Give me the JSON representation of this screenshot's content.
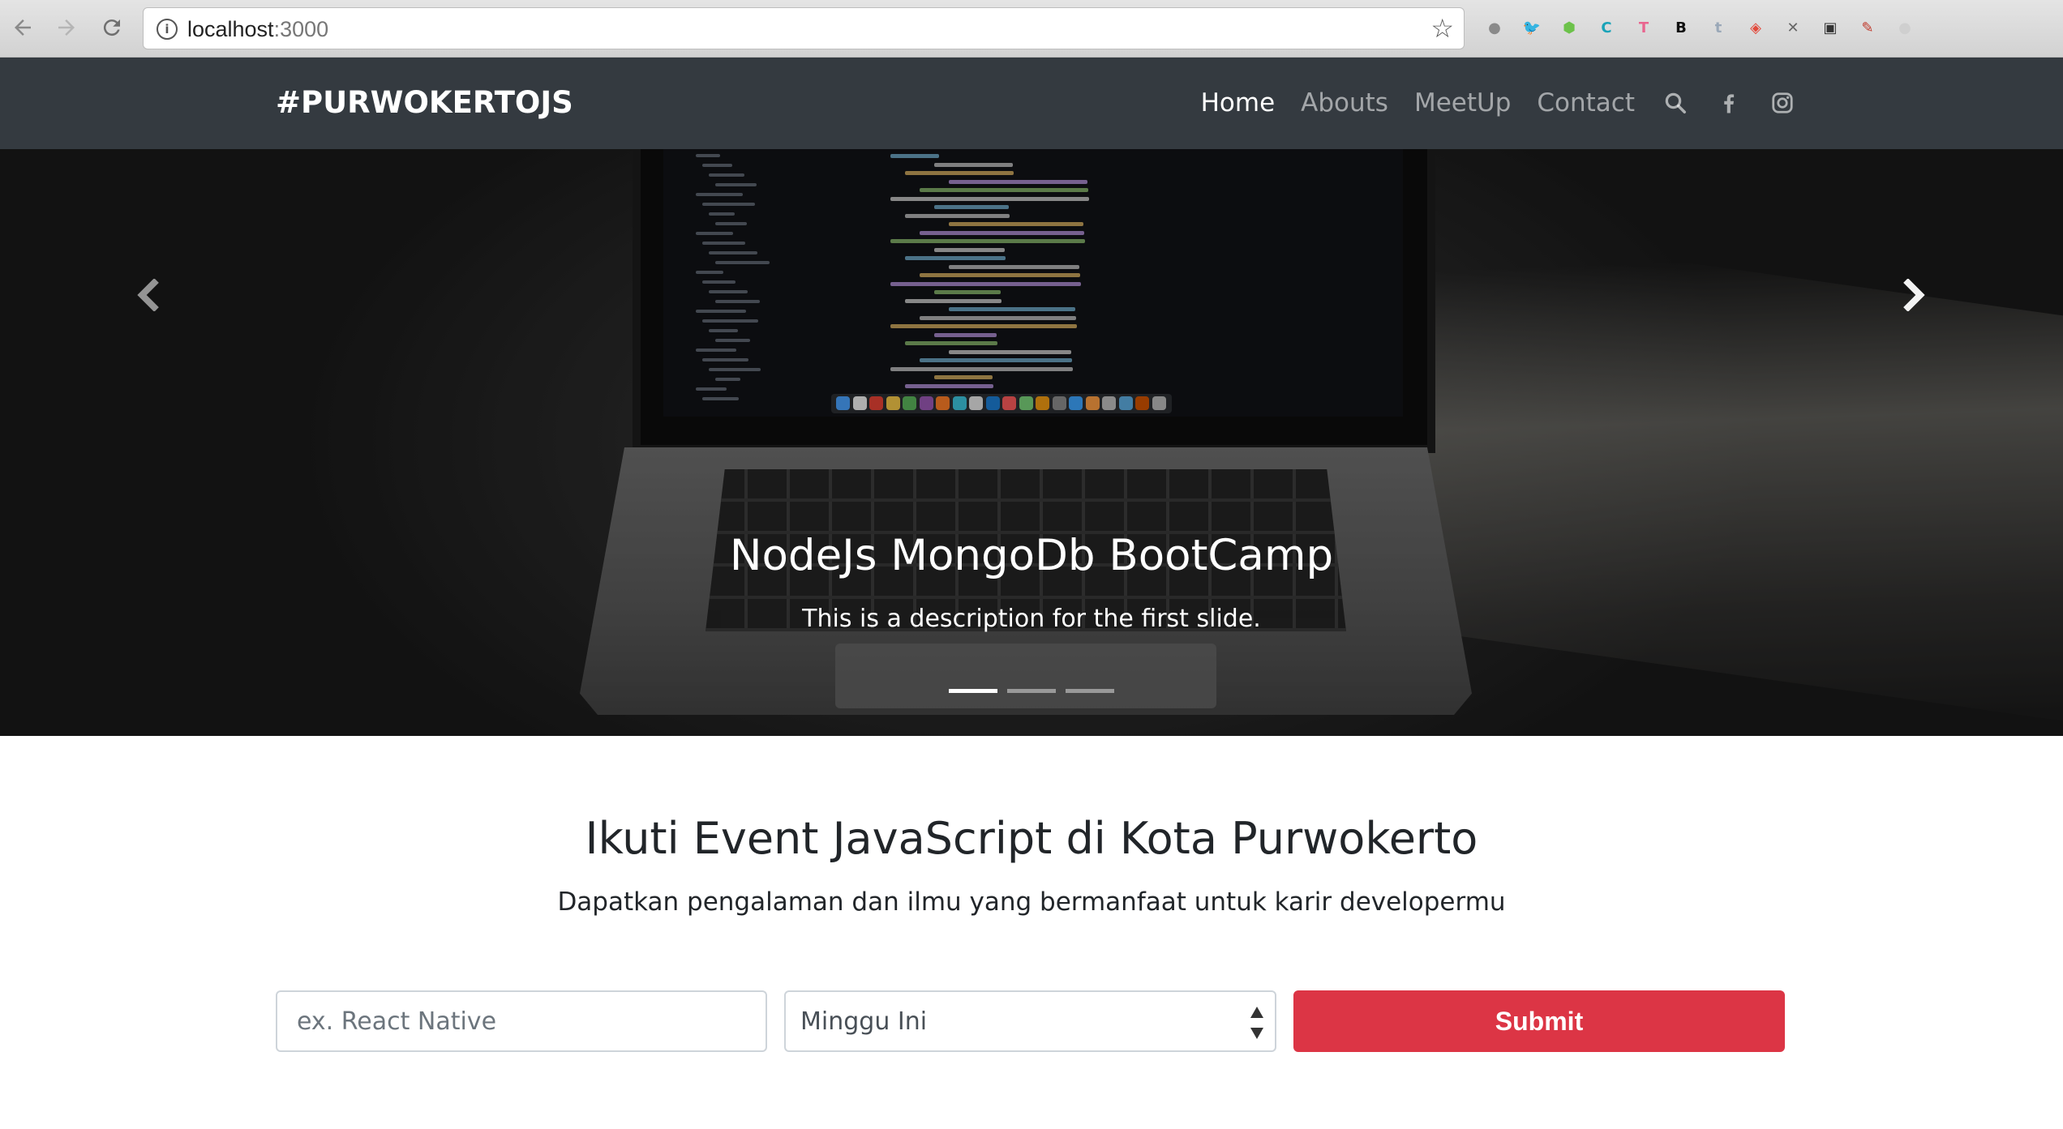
{
  "browser": {
    "url_host": "localhost",
    "url_port": ":3000",
    "back_icon": "arrow-left-icon",
    "forward_icon": "arrow-right-icon",
    "reload_icon": "reload-icon",
    "bookmark_icon": "star-icon",
    "extensions": [
      {
        "name": "circle-ext-icon",
        "glyph": "●",
        "color": "#8a8a8a"
      },
      {
        "name": "bird-ext-icon",
        "glyph": "🐦",
        "color": "#222222"
      },
      {
        "name": "node-ext-icon",
        "glyph": "⬢",
        "color": "#6cc24a"
      },
      {
        "name": "c-ext-icon",
        "glyph": "C",
        "color": "#1aa3b8"
      },
      {
        "name": "t-color-ext-icon",
        "glyph": "T",
        "color": "#e9658f"
      },
      {
        "name": "b-ext-icon",
        "glyph": "B",
        "color": "#111111"
      },
      {
        "name": "t-ext-icon",
        "glyph": "t",
        "color": "#9aa8b8"
      },
      {
        "name": "shield-ext-icon",
        "glyph": "◈",
        "color": "#e24a3c"
      },
      {
        "name": "x-ext-icon",
        "glyph": "✕",
        "color": "#666666"
      },
      {
        "name": "screen-ext-icon",
        "glyph": "▣",
        "color": "#333333"
      },
      {
        "name": "pen-ext-icon",
        "glyph": "✎",
        "color": "#c0392b"
      },
      {
        "name": "gray-ext-icon",
        "glyph": "●",
        "color": "#cfcfcf"
      }
    ]
  },
  "navbar": {
    "brand": "#PURWOKERTOJS",
    "links": [
      {
        "label": "Home",
        "active": true
      },
      {
        "label": "Abouts",
        "active": false
      },
      {
        "label": "MeetUp",
        "active": false
      },
      {
        "label": "Contact",
        "active": false
      }
    ],
    "icons": [
      "search-icon",
      "facebook-icon",
      "instagram-icon"
    ]
  },
  "carousel": {
    "slide_title": "NodeJs MongoDb BootCamp",
    "slide_description": "This is a description for the first slide.",
    "slide_count": 3,
    "active_index": 0,
    "prev_icon": "chevron-left-icon",
    "next_icon": "chevron-right-icon"
  },
  "main": {
    "heading": "Ikuti Event JavaScript di Kota Purwokerto",
    "subheading": "Dapatkan pengalaman dan ilmu yang bermanfaat untuk karir developermu"
  },
  "search_form": {
    "keyword_placeholder": "ex. React Native",
    "keyword_value": "",
    "period_selected": "Minggu Ini",
    "submit_label": "Submit",
    "submit_color": "#dc3545"
  }
}
